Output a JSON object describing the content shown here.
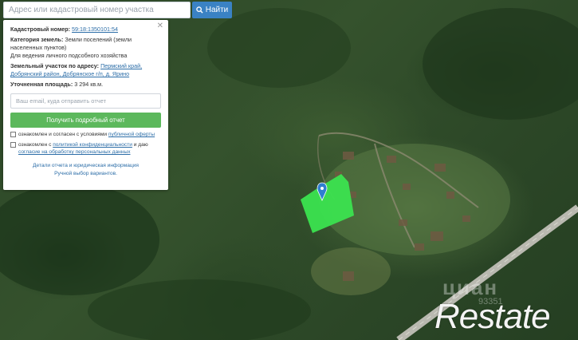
{
  "search": {
    "placeholder": "Адрес или кадастровый номер участка",
    "button_label": "Найти",
    "button_icon": "search-icon"
  },
  "panel": {
    "close_icon": "close-icon",
    "cadastral_label": "Кадастровый номер:",
    "cadastral_value": "59:18:1350101:54",
    "category_label": "Категория земель:",
    "category_value": "Земли поселений (земли населенных пунктов)",
    "usage_value": "Для ведения личного подсобного хозяйства",
    "address_label": "Земельный участок по адресу:",
    "address_value": "Пермский край, Добрянский район, Добрянское г/п, д. Ярино",
    "area_label": "Уточненная площадь:",
    "area_value": "3 294 кв.м.",
    "email_placeholder": "Ваш email, куда отправить отчет",
    "report_button": "Получить подробный отчет",
    "consent1_text": "ознакомлен и согласен с условиями ",
    "consent1_link": "публичной оферты",
    "consent2_text": "ознакомлен с ",
    "consent2_link1": "политикой конфиденциальности",
    "consent2_mid": " и даю ",
    "consent2_link2": "согласие на обработку персональных данных",
    "footer_link1": "Детали отчета и юридическая информация",
    "footer_link2": "Ручной выбор вариантов."
  },
  "watermark": {
    "cian": "циан",
    "cian_number": "93351",
    "restate": "Restate"
  },
  "colors": {
    "search_button": "#3a82c4",
    "report_button": "#5cb85c",
    "parcel_fill": "#3be34f",
    "marker": "#2f7fd0"
  }
}
